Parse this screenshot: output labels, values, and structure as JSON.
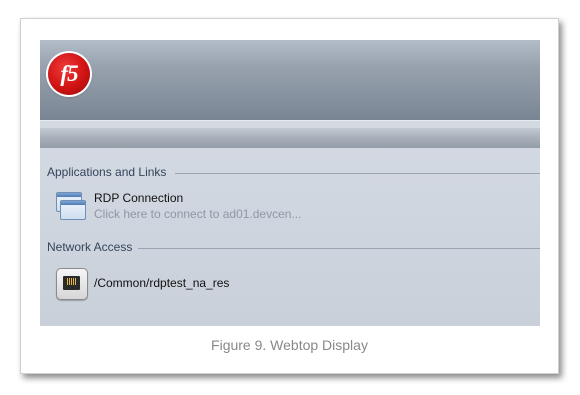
{
  "webtop": {
    "logo_text": "f5",
    "sections": [
      {
        "title": "Applications and Links",
        "items": [
          {
            "icon": "rdp-window-icon",
            "title": "RDP Connection",
            "subtitle": "Click here to connect to ad01.devcen..."
          }
        ]
      },
      {
        "title": "Network Access",
        "items": [
          {
            "icon": "network-jack-icon",
            "title": "/Common/rdptest_na_res"
          }
        ]
      }
    ]
  },
  "caption": "Figure 9. Webtop Display",
  "colors": {
    "header_top": "#b3bcc8",
    "header_bottom": "#7a8593",
    "logo_red": "#d01212",
    "section_title": "#33445c",
    "subtitle_gray": "#8e98a6",
    "caption_gray": "#888888"
  }
}
